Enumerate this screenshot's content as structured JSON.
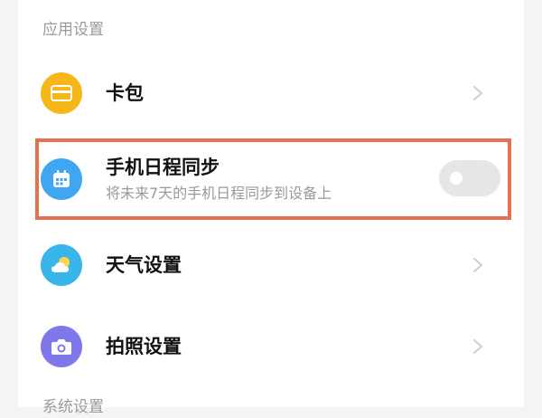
{
  "section_app_settings": "应用设置",
  "section_next_partial": "系统设置",
  "items": [
    {
      "title": "卡包",
      "icon": "card-icon",
      "color": "#f7b718",
      "has_chevron": true
    },
    {
      "title": "手机日程同步",
      "subtitle": "将未来7天的手机日程同步到设备上",
      "icon": "calendar-icon",
      "color": "#41a6f1",
      "toggle_on": false
    },
    {
      "title": "天气设置",
      "icon": "weather-icon",
      "color": "#38b6ec",
      "has_chevron": true
    },
    {
      "title": "拍照设置",
      "icon": "camera-icon",
      "color": "#7e78eb",
      "has_chevron": true
    }
  ],
  "colors": {
    "highlight_border": "#e5714d",
    "toggle_off_track": "#e6e6e6"
  }
}
